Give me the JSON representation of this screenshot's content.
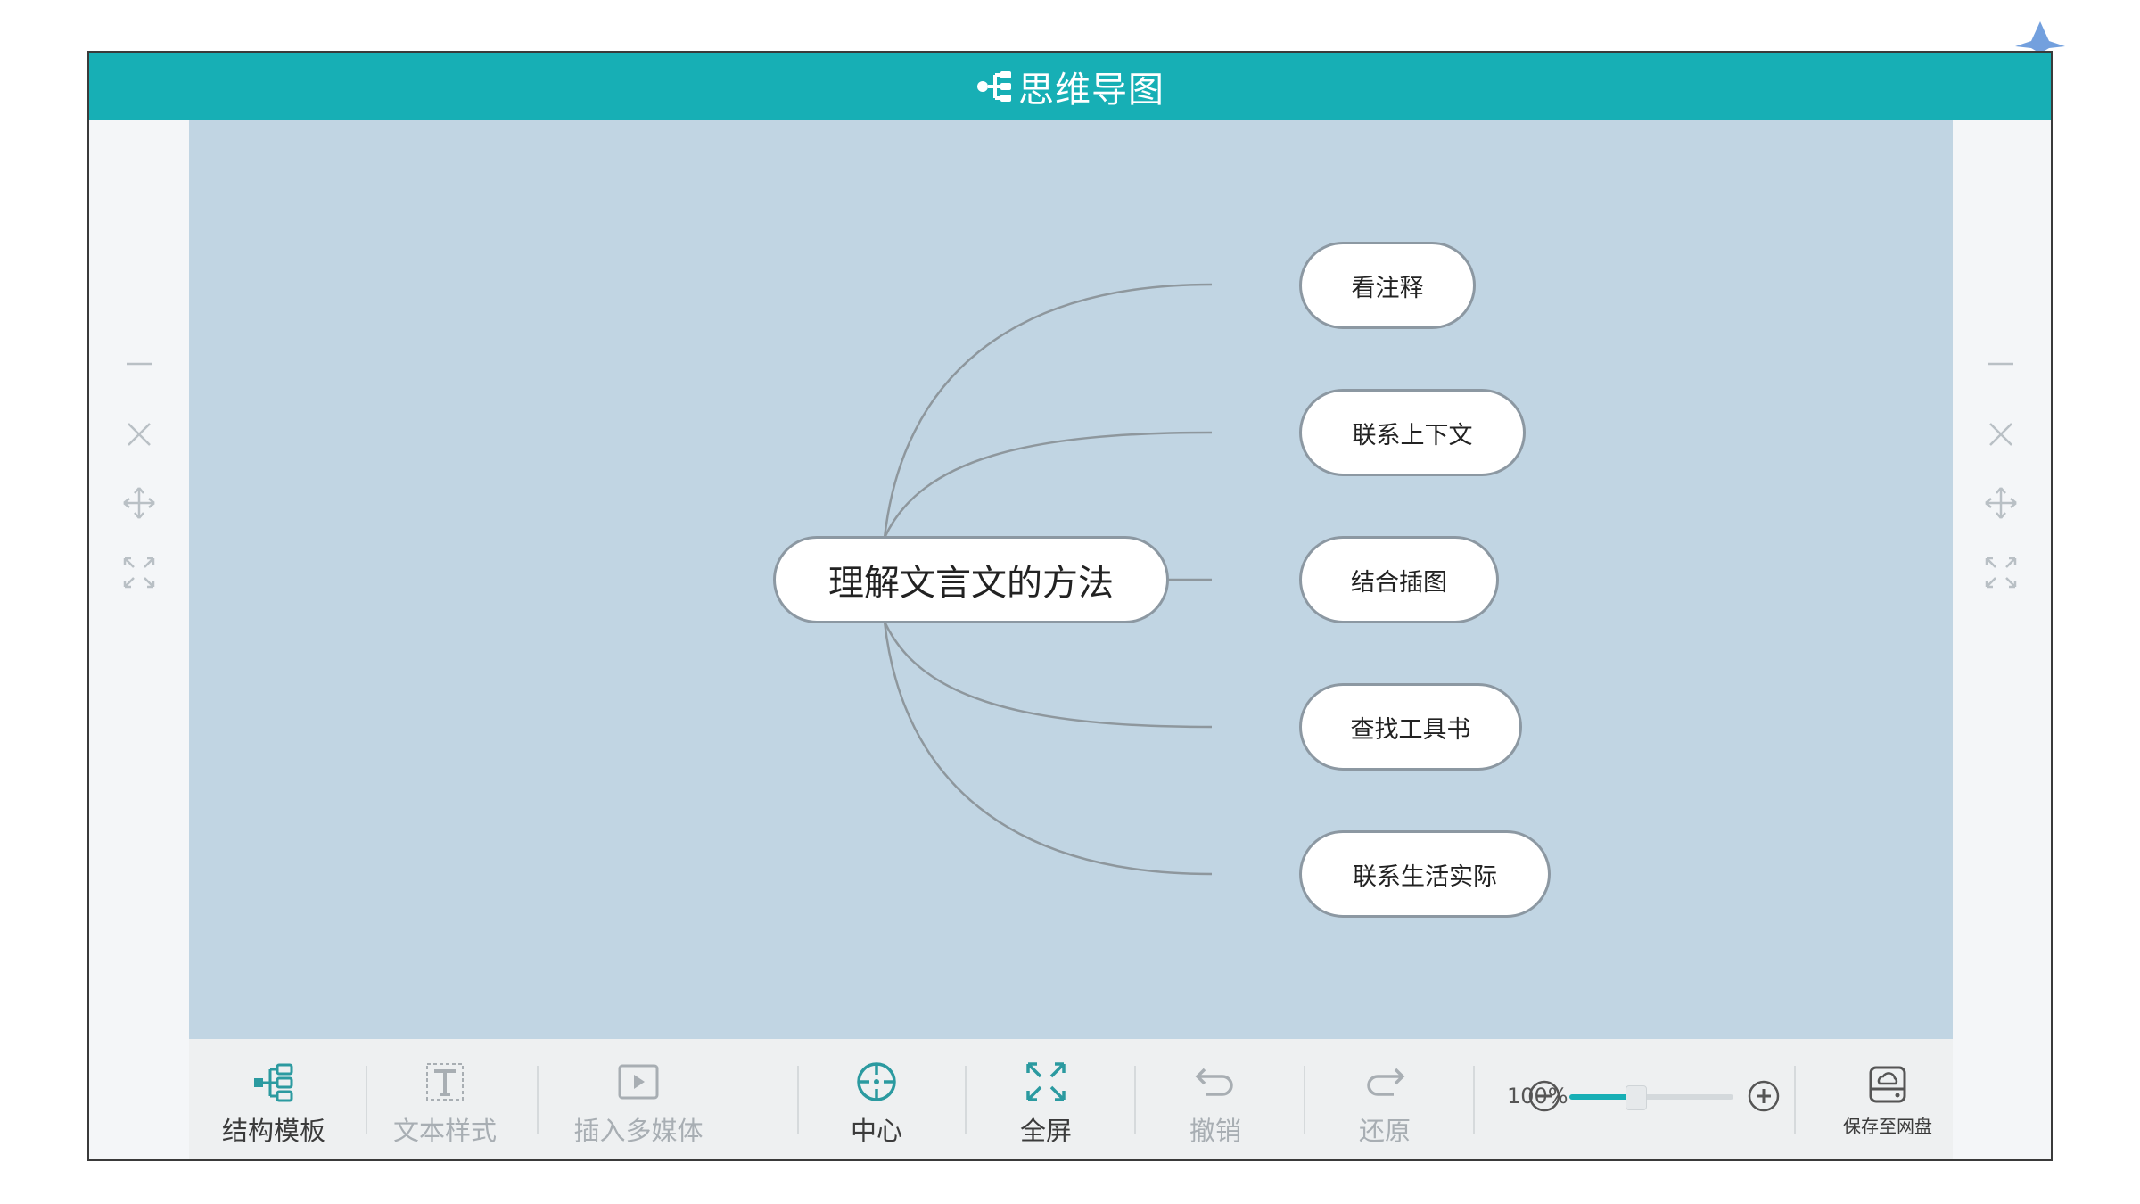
{
  "title": "思维导图",
  "colors": {
    "accent": "#17afb5",
    "canvas_bg": "#c1d5e3",
    "node_border": "#8c98a2",
    "link": "#8e979d"
  },
  "mindmap": {
    "central": "理解文言文的方法",
    "children": [
      {
        "label": "看注释"
      },
      {
        "label": "联系上下文"
      },
      {
        "label": "结合插图"
      },
      {
        "label": "查找工具书"
      },
      {
        "label": "联系生活实际"
      }
    ]
  },
  "side_controls": [
    {
      "name": "minimize",
      "icon": "minus-icon"
    },
    {
      "name": "close",
      "icon": "close-icon"
    },
    {
      "name": "move",
      "icon": "move-icon"
    },
    {
      "name": "expand",
      "icon": "expand-icon"
    }
  ],
  "toolbar": {
    "items": [
      {
        "label": "结构模板",
        "icon": "structure-icon",
        "enabled": true
      },
      {
        "label": "文本样式",
        "icon": "text-style-icon",
        "enabled": false
      },
      {
        "label": "插入多媒体",
        "icon": "media-icon",
        "enabled": false
      },
      {
        "label": "中心",
        "icon": "center-icon",
        "enabled": true
      },
      {
        "label": "全屏",
        "icon": "fullscreen-icon",
        "enabled": true
      },
      {
        "label": "撤销",
        "icon": "undo-icon",
        "enabled": false
      },
      {
        "label": "还原",
        "icon": "redo-icon",
        "enabled": false
      }
    ],
    "zoom": {
      "label": "100%",
      "level": 0.4
    },
    "save_label": "保存至网盘"
  }
}
